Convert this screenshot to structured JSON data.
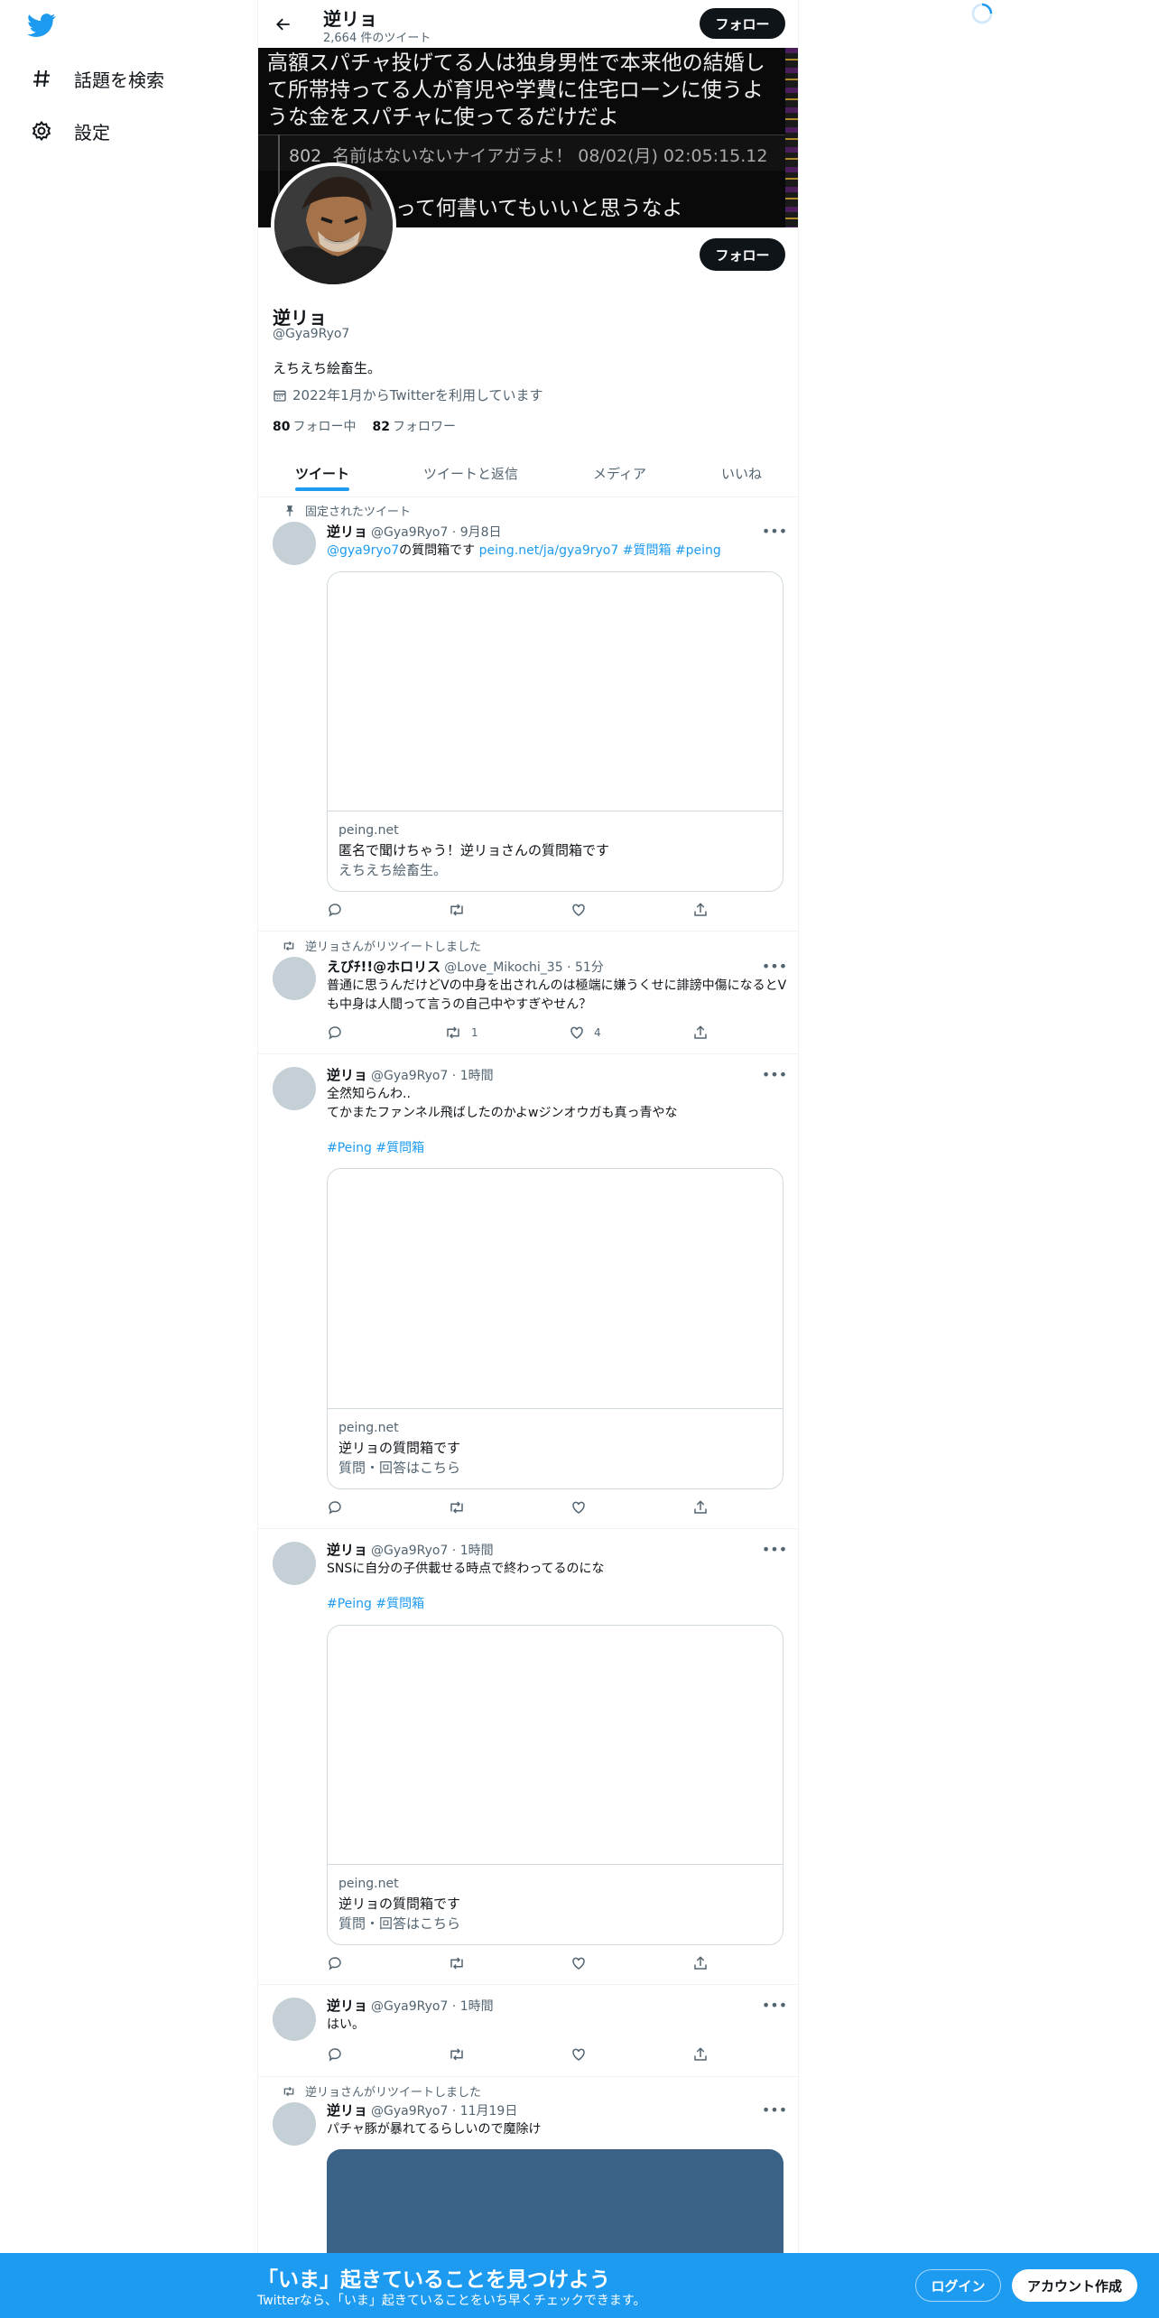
{
  "nav": {
    "logo_icon": "twitter-bird-icon",
    "items": [
      {
        "label": "話題を検索",
        "icon": "hashtag-icon"
      },
      {
        "label": "設定",
        "icon": "gear-icon"
      }
    ]
  },
  "header": {
    "name": "逆リョ",
    "tweet_count": "2,664 件のツイート",
    "follow_label": "フォロー"
  },
  "banner": {
    "text": "高額スパチャ投げてる人は独身男性で本来他の結婚して所帯持ってる人が育児や学費に住宅ローンに使うような金をスパチャに使ってるだけだよ",
    "meta_num": "802",
    "meta_rest": "名前はないないナイアガラよ！ 08/02(月) 02:05:15.12",
    "tail": "って何書いてもいいと思うなよ"
  },
  "profile": {
    "follow_label": "フォロー",
    "name": "逆リョ",
    "handle": "@Gya9Ryo7",
    "bio": "えちえち絵畜生。",
    "joined": "2022年1月からTwitterを利用しています",
    "following_count": "80",
    "following_label": "フォロー中",
    "followers_count": "82",
    "followers_label": "フォロワー"
  },
  "tabs": [
    {
      "label": "ツイート"
    },
    {
      "label": "ツイートと返信"
    },
    {
      "label": "メディア"
    },
    {
      "label": "いいね"
    }
  ],
  "tweets": [
    {
      "context": "固定されたツイート",
      "name": "逆リョ",
      "meta": "@Gya9Ryo7 · 9月8日",
      "mention": "@gya9ryo7",
      "text_mid": "の質問箱です",
      "link": "peing.net/ja/gya9ryo7",
      "tags": "#質問箱 #peing",
      "card": {
        "domain": "peing.net",
        "title": "匿名で聞けちゃう！逆リョさんの質問箱です",
        "desc": "えちえち絵畜生。"
      }
    },
    {
      "context": "逆リョさんがリツイートしました",
      "name": "えびﾁ!!@ホロリス",
      "meta": "@Love_Mikochi_35 · 51分",
      "text": "普通に思うんだけどVの中身を出されんのは極端に嫌うくせに誹謗中傷になるとVも中身は人間って言うの自己中やすぎやせん？",
      "retweets": "1",
      "likes": "4"
    },
    {
      "name": "逆リョ",
      "meta": "@Gya9Ryo7 · 1時間",
      "text1": "全然知らんわ..",
      "text2": "てかまたファンネル飛ばしたのかよwジンオウガも真っ青やな",
      "tags": "#Peing #質問箱",
      "card": {
        "domain": "peing.net",
        "title": "逆リョの質問箱です",
        "desc": "質問・回答はこちら"
      }
    },
    {
      "name": "逆リョ",
      "meta": "@Gya9Ryo7 · 1時間",
      "text": "SNSに自分の子供載せる時点で終わってるのにな",
      "tags": "#Peing #質問箱",
      "card": {
        "domain": "peing.net",
        "title": "逆リョの質問箱です",
        "desc": "質問・回答はこちら"
      }
    },
    {
      "name": "逆リョ",
      "meta": "@Gya9Ryo7 · 1時間",
      "text": "はい。"
    },
    {
      "context": "逆リョさんがリツイートしました",
      "name": "逆リョ",
      "meta": "@Gya9Ryo7 · 11月19日",
      "text": "パチャ豚が暴れてるらしいので魔除け",
      "media_color": "#3a6186"
    }
  ],
  "bottom": {
    "title": "「いま」起きていることを見つけよう",
    "subtitle": "Twitterなら、「いま」起きていることをいち早くチェックできます。",
    "login": "ログイン",
    "signup": "アカウント作成"
  },
  "colors": {
    "accent": "#1d9bf0",
    "text": "#0f1419",
    "muted": "#536471"
  }
}
